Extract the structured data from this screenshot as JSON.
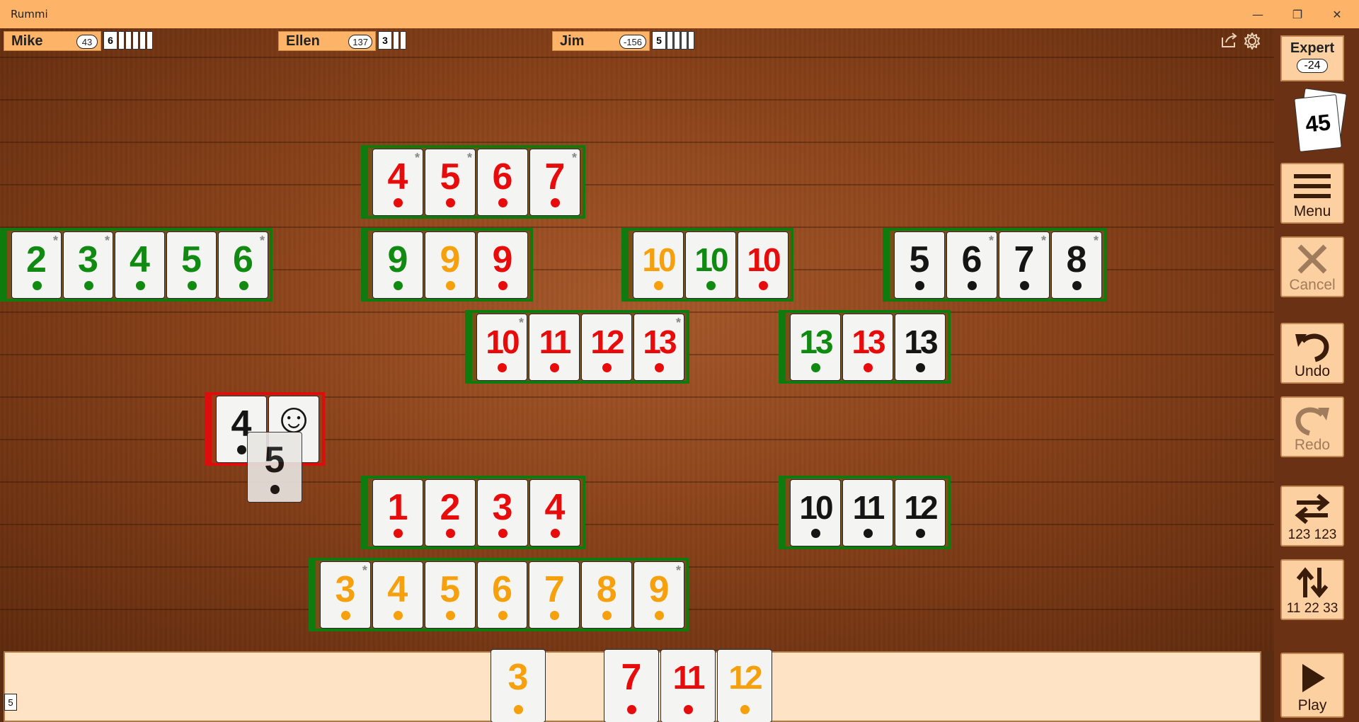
{
  "window": {
    "title": "Rummi"
  },
  "players": [
    {
      "name": "Mike",
      "score": "43",
      "tiles": "6"
    },
    {
      "name": "Ellen",
      "score": "137",
      "tiles": "3"
    },
    {
      "name": "Jim",
      "score": "-156",
      "tiles": "5"
    }
  ],
  "sidebar": {
    "level": "Expert",
    "level_score": "-24",
    "pool_count": "45",
    "buttons": {
      "menu": "Menu",
      "cancel": "Cancel",
      "undo": "Undo",
      "redo": "Redo",
      "sort_color": "123 123",
      "sort_number": "11 22 33",
      "play": "Play"
    }
  },
  "rack": {
    "count": "5"
  },
  "colors": {
    "red": "#e80b0b",
    "green": "#108a10",
    "orange": "#f5a00c",
    "black": "#151515",
    "valid_set": "#0f7b0f",
    "invalid_set": "#dd0d0d"
  },
  "table_sets": [
    {
      "id": "set1",
      "valid": true,
      "tiles": [
        {
          "n": "4",
          "c": "red",
          "j": true
        },
        {
          "n": "5",
          "c": "red",
          "j": true
        },
        {
          "n": "6",
          "c": "red"
        },
        {
          "n": "7",
          "c": "red",
          "j": true
        }
      ]
    },
    {
      "id": "set2",
      "valid": true,
      "tiles": [
        {
          "n": "2",
          "c": "green",
          "j": true
        },
        {
          "n": "3",
          "c": "green",
          "j": true
        },
        {
          "n": "4",
          "c": "green"
        },
        {
          "n": "5",
          "c": "green"
        },
        {
          "n": "6",
          "c": "green",
          "j": true
        }
      ]
    },
    {
      "id": "set3",
      "valid": true,
      "tiles": [
        {
          "n": "9",
          "c": "green"
        },
        {
          "n": "9",
          "c": "orange"
        },
        {
          "n": "9",
          "c": "red"
        }
      ]
    },
    {
      "id": "set4",
      "valid": true,
      "tiles": [
        {
          "n": "10",
          "c": "orange"
        },
        {
          "n": "10",
          "c": "green"
        },
        {
          "n": "10",
          "c": "red"
        }
      ]
    },
    {
      "id": "set5",
      "valid": true,
      "tiles": [
        {
          "n": "5",
          "c": "black"
        },
        {
          "n": "6",
          "c": "black",
          "j": true
        },
        {
          "n": "7",
          "c": "black",
          "j": true
        },
        {
          "n": "8",
          "c": "black",
          "j": true
        }
      ]
    },
    {
      "id": "set6",
      "valid": true,
      "tiles": [
        {
          "n": "10",
          "c": "red",
          "j": true
        },
        {
          "n": "11",
          "c": "red"
        },
        {
          "n": "12",
          "c": "red"
        },
        {
          "n": "13",
          "c": "red",
          "j": true
        }
      ]
    },
    {
      "id": "set7",
      "valid": true,
      "tiles": [
        {
          "n": "13",
          "c": "green"
        },
        {
          "n": "13",
          "c": "red"
        },
        {
          "n": "13",
          "c": "black"
        }
      ]
    },
    {
      "id": "set8",
      "valid": false,
      "tiles": [
        {
          "n": "4",
          "c": "black"
        },
        {
          "n": "☺",
          "c": "black",
          "joker": true
        }
      ]
    },
    {
      "id": "set9",
      "valid": true,
      "tiles": [
        {
          "n": "1",
          "c": "red"
        },
        {
          "n": "2",
          "c": "red"
        },
        {
          "n": "3",
          "c": "red"
        },
        {
          "n": "4",
          "c": "red"
        }
      ]
    },
    {
      "id": "set10",
      "valid": true,
      "tiles": [
        {
          "n": "10",
          "c": "black"
        },
        {
          "n": "11",
          "c": "black"
        },
        {
          "n": "12",
          "c": "black"
        }
      ]
    },
    {
      "id": "set11",
      "valid": true,
      "tiles": [
        {
          "n": "3",
          "c": "orange",
          "j": true
        },
        {
          "n": "4",
          "c": "orange"
        },
        {
          "n": "5",
          "c": "orange"
        },
        {
          "n": "6",
          "c": "orange"
        },
        {
          "n": "7",
          "c": "orange"
        },
        {
          "n": "8",
          "c": "orange"
        },
        {
          "n": "9",
          "c": "orange",
          "j": true
        }
      ]
    }
  ],
  "dragged_tile": {
    "n": "5",
    "c": "black"
  },
  "rack_tiles": [
    {
      "n": "3",
      "c": "orange"
    },
    {
      "n": "7",
      "c": "red"
    },
    {
      "n": "11",
      "c": "red"
    },
    {
      "n": "12",
      "c": "orange"
    }
  ]
}
